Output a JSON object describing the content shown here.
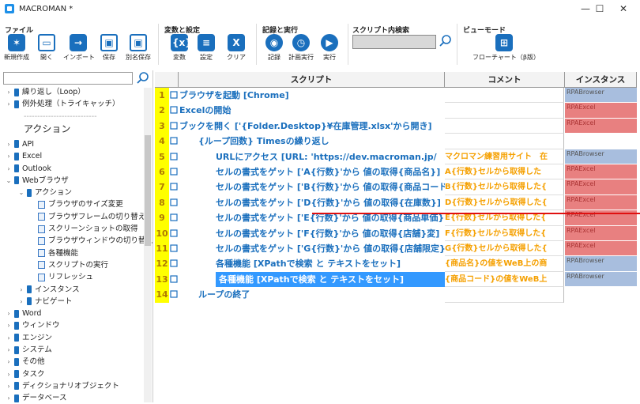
{
  "window": {
    "title": "MACROMAN *",
    "minimize": "—",
    "maximize": "☐",
    "close": "✕"
  },
  "ribbon": {
    "groups": [
      {
        "title": "ファイル",
        "buttons": [
          {
            "label": "新規作成",
            "icon": "new-file-icon",
            "glyph": "✶"
          },
          {
            "label": "開く",
            "icon": "folder-icon",
            "glyph": "▭"
          },
          {
            "label": "インポート",
            "icon": "import-icon",
            "glyph": "→"
          },
          {
            "label": "保存",
            "icon": "save-icon",
            "glyph": "▣"
          },
          {
            "label": "別名保存",
            "icon": "save-as-icon",
            "glyph": "▣"
          }
        ]
      },
      {
        "title": "変数と設定",
        "buttons": [
          {
            "label": "変数",
            "icon": "variable-icon",
            "glyph": "{x}"
          },
          {
            "label": "設定",
            "icon": "settings-icon",
            "glyph": "≡"
          },
          {
            "label": "クリア",
            "icon": "clear-icon",
            "glyph": "X"
          }
        ]
      },
      {
        "title": "記録と実行",
        "buttons": [
          {
            "label": "記録",
            "icon": "record-icon",
            "glyph": "◉"
          },
          {
            "label": "計画実行",
            "icon": "schedule-icon",
            "glyph": "◷"
          },
          {
            "label": "実行",
            "icon": "play-icon",
            "glyph": "▶"
          }
        ]
      },
      {
        "title": "スクリプト内検索"
      },
      {
        "title": "ビューモード",
        "buttons": [
          {
            "label": "フローチャート（β版）",
            "icon": "flowchart-icon",
            "glyph": "⊞"
          }
        ]
      }
    ]
  },
  "sidebar": {
    "items": [
      {
        "label": "繰り返し（Loop）",
        "kind": "book",
        "expander": "›"
      },
      {
        "label": "例外処理（トライキャッチ）",
        "kind": "book",
        "expander": "›"
      },
      {
        "label": "---------------------------",
        "kind": "sep"
      },
      {
        "label": "アクション",
        "kind": "heading"
      },
      {
        "label": "API",
        "kind": "book",
        "expander": "›"
      },
      {
        "label": "Excel",
        "kind": "book",
        "expander": "›"
      },
      {
        "label": "Outlook",
        "kind": "book",
        "expander": "›"
      },
      {
        "label": "Webブラウザ",
        "kind": "book",
        "expander": "⌄"
      },
      {
        "label": "アクション",
        "kind": "book",
        "expander": "⌄"
      },
      {
        "label": "ブラウザのサイズ変更",
        "kind": "doc"
      },
      {
        "label": "ブラウザフレームの切り替え",
        "kind": "doc"
      },
      {
        "label": "スクリーンショットの取得",
        "kind": "doc"
      },
      {
        "label": "ブラウザウィンドウの切り替え",
        "kind": "doc"
      },
      {
        "label": "各種機能",
        "kind": "doc"
      },
      {
        "label": "スクリプトの実行",
        "kind": "doc"
      },
      {
        "label": "リフレッシュ",
        "kind": "doc"
      },
      {
        "label": "インスタンス",
        "kind": "book",
        "expander": "›"
      },
      {
        "label": "ナビゲート",
        "kind": "book",
        "expander": "›"
      },
      {
        "label": "Word",
        "kind": "book",
        "expander": "›"
      },
      {
        "label": "ウィンドウ",
        "kind": "book",
        "expander": "›"
      },
      {
        "label": "エンジン",
        "kind": "book",
        "expander": "›"
      },
      {
        "label": "システム",
        "kind": "book",
        "expander": "›"
      },
      {
        "label": "その他",
        "kind": "book",
        "expander": "›"
      },
      {
        "label": "タスク",
        "kind": "book",
        "expander": "›"
      },
      {
        "label": "ディクショナリオブジェクト",
        "kind": "book",
        "expander": "›"
      },
      {
        "label": "データベース",
        "kind": "book",
        "expander": "›"
      }
    ]
  },
  "grid": {
    "headers": {
      "script": "スクリプト",
      "comment": "コメント",
      "instance": "インスタンス"
    },
    "rows": [
      {
        "num": "1",
        "indent": 0,
        "text": "ブラウザを起動 [Chrome]",
        "comment": "",
        "instance": "RPABrowser",
        "inst_color": "b",
        "icon": "browser-icon"
      },
      {
        "num": "2",
        "indent": 0,
        "text": "Excelの開始",
        "comment": "",
        "instance": "RPAExcel",
        "inst_color": "r",
        "icon": "excel-icon"
      },
      {
        "num": "3",
        "indent": 0,
        "text": "ブックを開く ['{Folder.Desktop}¥在庫管理.xlsx'から開き]",
        "comment": "",
        "instance": "RPAExcel",
        "inst_color": "r",
        "icon": "excel-icon"
      },
      {
        "num": "4",
        "indent": 1,
        "text": "{ループ回数} Timesの繰り返し",
        "comment": "",
        "instance": "",
        "inst_color": "",
        "icon": "loop-icon"
      },
      {
        "num": "5",
        "indent": 2,
        "text": "URLにアクセス [URL: 'https://dev.macroman.jp/",
        "comment": "マクロマン練習用サイト　在",
        "instance": "RPABrowser",
        "inst_color": "b",
        "icon": "browser-icon"
      },
      {
        "num": "6",
        "indent": 2,
        "text": "セルの書式をゲット ['A{行数}'から 値の取得{商品名}]",
        "comment": "A{行数}セルから取得した",
        "instance": "RPAExcel",
        "inst_color": "r",
        "icon": "excel-icon"
      },
      {
        "num": "7",
        "indent": 2,
        "text": "セルの書式をゲット ['B{行数}'から 値の取得{商品コード}]",
        "comment": "B{行数}セルから取得した{",
        "instance": "RPAExcel",
        "inst_color": "r",
        "icon": "excel-icon"
      },
      {
        "num": "8",
        "indent": 2,
        "text": "セルの書式をゲット ['D{行数}'から 値の取得{在庫数}]",
        "comment": "D{行数}セルから取得した{",
        "instance": "RPAExcel",
        "inst_color": "r",
        "icon": "excel-icon"
      },
      {
        "num": "9",
        "indent": 2,
        "text": "セルの書式をゲット ['E{行数}'から 値の取得{商品単価}]",
        "comment": "E{行数}セルから取得した{",
        "instance": "RPAExcel",
        "inst_color": "r",
        "icon": "excel-icon"
      },
      {
        "num": "10",
        "indent": 2,
        "text": "セルの書式をゲット ['F{行数}'から 値の取得{店舗}変]",
        "comment": "F{行数}セルから取得した{",
        "instance": "RPAExcel",
        "inst_color": "r",
        "icon": "excel-icon"
      },
      {
        "num": "11",
        "indent": 2,
        "text": "セルの書式をゲット ['G{行数}'から 値の取得{店舗限定}]",
        "comment": "G{行数}セルから取得した{",
        "instance": "RPAExcel",
        "inst_color": "r",
        "icon": "excel-icon"
      },
      {
        "num": "12",
        "indent": 2,
        "text": "各種機能 [XPathで検索 と テキストをセット]",
        "comment": "{商品名}の値をWeB上の商",
        "instance": "RPABrowser",
        "inst_color": "b",
        "icon": "browser-icon"
      },
      {
        "num": "13",
        "indent": 2,
        "text": "各種機能 [XPathで検索 と テキストをセット]",
        "comment": "{商品コード}の値をWeB上",
        "instance": "RPABrowser",
        "inst_color": "b",
        "icon": "browser-icon",
        "selected": true
      },
      {
        "num": "14",
        "indent": 1,
        "text": "ループの終了",
        "comment": "",
        "instance": "",
        "inst_color": "",
        "icon": "loop-end-icon"
      }
    ]
  },
  "colors": {
    "accent": "#1a6fbd",
    "selection": "#3399ff",
    "row_number_bg": "#ffff00",
    "comment_text": "#f5a000",
    "instance_browser": "#a8bede",
    "instance_excel": "#e88080",
    "drop_marker": "#e01010"
  }
}
